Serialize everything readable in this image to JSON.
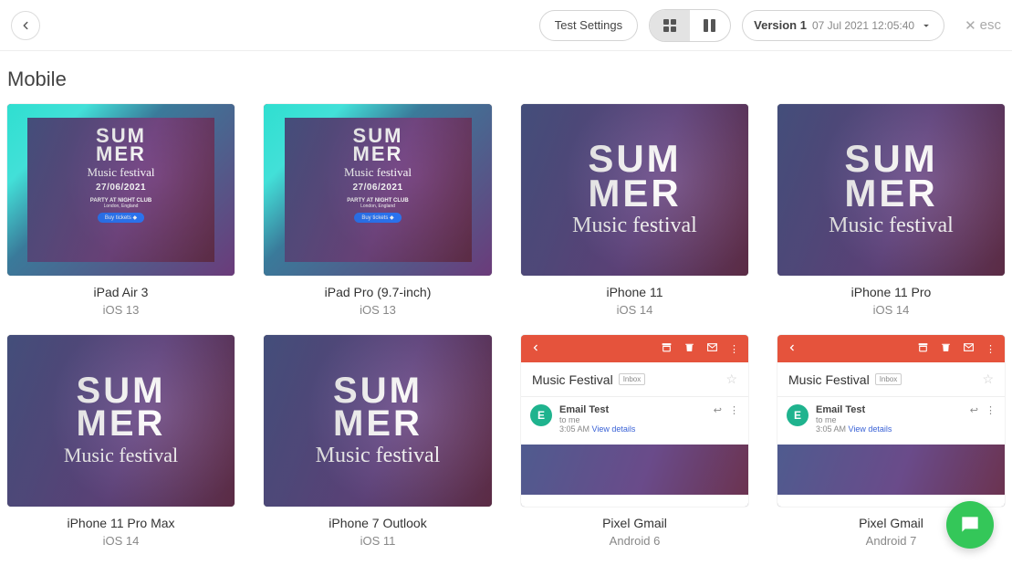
{
  "toolbar": {
    "test_settings_label": "Test Settings",
    "version_name": "Version 1",
    "version_date": "07 Jul 2021 12:05:40",
    "esc_label": "esc"
  },
  "section_title": "Mobile",
  "poster": {
    "line1": "SUM",
    "line2": "MER",
    "subtitle": "Music festival",
    "date": "27/06/2021",
    "party": "PARTY AT NIGHT CLUB",
    "location": "London, England",
    "button": "Buy tickets ◆"
  },
  "gmail": {
    "subject": "Music Festival",
    "inbox_label": "Inbox",
    "sender": "Email Test",
    "recipient": "to me",
    "time": "3:05 AM",
    "view_details": "View details",
    "avatar_letter": "E"
  },
  "devices": [
    {
      "name": "iPad Air 3",
      "os": "iOS 13",
      "kind": "poster"
    },
    {
      "name": "iPad Pro (9.7-inch)",
      "os": "iOS 13",
      "kind": "poster"
    },
    {
      "name": "iPhone 11",
      "os": "iOS 14",
      "kind": "zoom"
    },
    {
      "name": "iPhone 11 Pro",
      "os": "iOS 14",
      "kind": "zoom"
    },
    {
      "name": "iPhone 11 Pro Max",
      "os": "iOS 14",
      "kind": "zoom"
    },
    {
      "name": "iPhone 7 Outlook",
      "os": "iOS 11",
      "kind": "zoom-narrow"
    },
    {
      "name": "Pixel Gmail",
      "os": "Android 6",
      "kind": "gmail"
    },
    {
      "name": "Pixel Gmail",
      "os": "Android 7",
      "kind": "gmail"
    }
  ]
}
